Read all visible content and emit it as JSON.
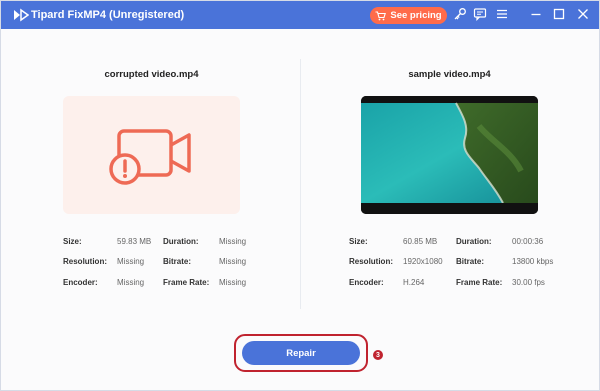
{
  "app": {
    "title": "Tipard FixMP4 (Unregistered)",
    "pricing_label": "See pricing"
  },
  "titlebar_icons": [
    "key-icon",
    "feedback-icon",
    "menu-icon",
    "minimize-icon",
    "maximize-icon",
    "close-icon"
  ],
  "colors": {
    "titlebar": "#4a73d9",
    "pricing": "#ff6b4a",
    "corrupt_icon": "#ee6a55",
    "corrupt_bg": "#fdf0ec",
    "highlight": "#c0232f"
  },
  "left": {
    "filename": "corrupted video.mp4",
    "size_label": "Size:",
    "size": "59.83 MB",
    "duration_label": "Duration:",
    "duration": "Missing",
    "resolution_label": "Resolution:",
    "resolution": "Missing",
    "bitrate_label": "Bitrate:",
    "bitrate": "Missing",
    "encoder_label": "Encoder:",
    "encoder": "Missing",
    "framerate_label": "Frame Rate:",
    "framerate": "Missing"
  },
  "right": {
    "filename": "sample video.mp4",
    "size_label": "Size:",
    "size": "60.85 MB",
    "duration_label": "Duration:",
    "duration": "00:00:36",
    "resolution_label": "Resolution:",
    "resolution": "1920x1080",
    "bitrate_label": "Bitrate:",
    "bitrate": "13800 kbps",
    "encoder_label": "Encoder:",
    "encoder": "H.264",
    "framerate_label": "Frame Rate:",
    "framerate": "30.00 fps"
  },
  "repair": {
    "label": "Repair",
    "step": "3"
  }
}
